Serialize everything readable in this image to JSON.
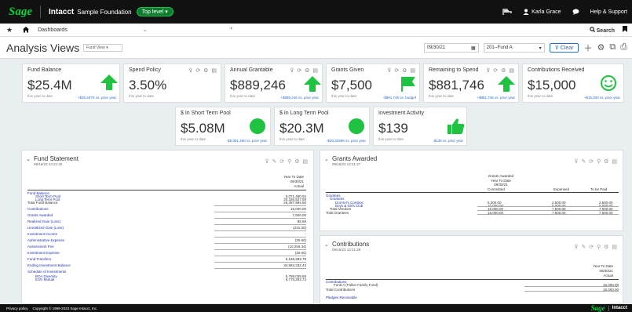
{
  "topbar": {
    "brand": "Sage",
    "product": "Intacct",
    "company": "Sample Foundation",
    "entity": "Top level",
    "user": "Karla Grace",
    "help": "Help & Support"
  },
  "navbar": {
    "dashboard": "Dashboards",
    "search": "Search"
  },
  "page": {
    "title": "Analysis Views",
    "view": "Fund View",
    "date": "09/30/21",
    "fund": "201--Fund A",
    "clear": "Clear"
  },
  "cards": [
    {
      "title": "Fund Balance",
      "value": "$25.4M",
      "sub": "this year to date",
      "cmp": "+$25.407K vs. prior year",
      "indicator": "up-arrow"
    },
    {
      "title": "Spend Policy",
      "value": "3.50%",
      "sub": "this year to date",
      "cmp": "",
      "indicator": "none"
    },
    {
      "title": "Annual Grantable",
      "value": "$889,246",
      "sub": "this year to date",
      "cmp": "+$889,246 vs. prior year",
      "indicator": "up-arrow"
    },
    {
      "title": "Grants Given",
      "value": "$7,500",
      "sub": "this year to date",
      "cmp": "-$881,746 vs. budget",
      "indicator": "flag"
    },
    {
      "title": "Remaining to Spend",
      "value": "$881,746",
      "sub": "this year to date",
      "cmp": "+$881,746 vs. prior year",
      "indicator": "up-arrow"
    },
    {
      "title": "Contributions Received",
      "value": "$15,000",
      "sub": "this year to date",
      "cmp": "+$15,000 vs. prior year",
      "indicator": "smiley"
    },
    {
      "title": "$ In Short Term Pool",
      "value": "$5.08M",
      "sub": "this year to date",
      "cmp": "-$5,081,460 vs. prior year",
      "indicator": "dot"
    },
    {
      "title": "$ In Long Term Pool",
      "value": "$20.3M",
      "sub": "this year to date",
      "cmp": "-$20,32995 vs. prior year",
      "indicator": "dot"
    },
    {
      "title": "Investment Activity",
      "value": "$139",
      "sub": "this year to date",
      "cmp": "-$139 vs. prior year",
      "indicator": "thumbs-up"
    }
  ],
  "fund_statement": {
    "title": "Fund Statement",
    "date": "09/16/23 13:21:25",
    "col_header": [
      "Year To Date",
      "09/30/21",
      "Actual"
    ],
    "rows": [
      {
        "label": "Fund Balance",
        "value": "",
        "style": "blue"
      },
      {
        "label": "Short Term Pool",
        "value": "5,071,480.92",
        "style": "indent"
      },
      {
        "label": "Long Term Pool",
        "value": "20,326,527.59",
        "style": "indent"
      },
      {
        "label": "Total Fund Balance",
        "value": "25,397,994.50",
        "style": "black"
      },
      {
        "label": "Contributions",
        "value": "15,000.00",
        "style": "blue"
      },
      {
        "label": "Grants Awarded",
        "value": "7,500.00",
        "style": "blue"
      },
      {
        "label": "Realized Gain (Loss)",
        "value": "85.68",
        "style": "blue"
      },
      {
        "label": "Unrealized Gain (Loss)",
        "value": "(231.30)",
        "style": "blue"
      },
      {
        "label": "Investment Income",
        "value": "-",
        "style": "blue"
      },
      {
        "label": "Administrative Expense",
        "value": "(30.60)",
        "style": "blue"
      },
      {
        "label": "Assessment Fee",
        "value": "(10,255.34)",
        "style": "blue"
      },
      {
        "label": "Investment Expense",
        "value": "(30.60)",
        "style": "blue"
      },
      {
        "label": "Fund Transfers",
        "value": "9,168,283.79",
        "style": "blue"
      },
      {
        "label": "Ending Investment Balance",
        "value": "34,583,332.43",
        "style": "blue"
      },
      {
        "label": "Schedule of Investments",
        "value": "",
        "style": "blue"
      },
      {
        "label": "BOA Diversity",
        "value": "5,798,039.59",
        "style": "indent"
      },
      {
        "label": "ESG Mutual",
        "value": "6,775,283.72",
        "style": "indent"
      }
    ]
  },
  "grants_awarded": {
    "title": "Grants Awarded",
    "date": "09/16/23 13:21:27",
    "col_header": [
      "Grants Awarded",
      "Year To Date",
      "09/30/21"
    ],
    "columns": [
      "Committed",
      "Expensed",
      "To be Paid"
    ],
    "rows": [
      {
        "label": "Grantees",
        "cells": [
          "",
          "",
          ""
        ],
        "style": "blue"
      },
      {
        "label": "Grantees",
        "cells": [
          "",
          "",
          ""
        ],
        "style": "indent1"
      },
      {
        "label": "Don'sH's Combos",
        "cells": [
          "5,000.00",
          "2,500.00",
          "2,500.00"
        ],
        "style": "indent2"
      },
      {
        "label": "Boys & Girls Club",
        "cells": [
          "10,000.00",
          "5,000.00",
          "5,000.00"
        ],
        "style": "indent2"
      },
      {
        "label": "Total Vendors",
        "cells": [
          "15,000.00",
          "7,500.00",
          "7,500.00"
        ],
        "style": "indent1b"
      },
      {
        "label": "Total Grantees",
        "cells": [
          "15,000.00",
          "7,500.00",
          "7,500.00"
        ],
        "style": "black"
      }
    ]
  },
  "contributions": {
    "title": "Contributions",
    "date": "09/16/23 13:21:28",
    "col_header": [
      "Year To Date",
      "09/30/21",
      "Actual"
    ],
    "rows": [
      {
        "label": "Contributions",
        "value": "",
        "style": "blue"
      },
      {
        "label": "Fund A (Fallon Family Fund)",
        "value": "15,000.00",
        "style": "indent"
      },
      {
        "label": "Total Contributions",
        "value": "15,000.00",
        "style": "black"
      },
      {
        "label": "Pledges Receivable",
        "value": "",
        "style": "blue"
      }
    ]
  },
  "footer": {
    "privacy": "Privacy policy",
    "copyright": "Copyright © 1999-2023 Sage Intacct, Inc.",
    "brand": "Sage",
    "product": "Intacct"
  }
}
